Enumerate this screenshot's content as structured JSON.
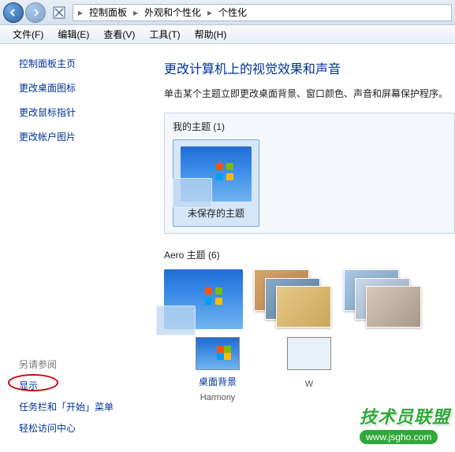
{
  "breadcrumb": {
    "items": [
      "控制面板",
      "外观和个性化",
      "个性化"
    ]
  },
  "menu": {
    "items": [
      "文件(F)",
      "编辑(E)",
      "查看(V)",
      "工具(T)",
      "帮助(H)"
    ]
  },
  "sidebar": {
    "title": "控制面板主页",
    "links": [
      "更改桌面图标",
      "更改鼠标指针",
      "更改帐户图片"
    ],
    "seeAlsoTitle": "另请参阅",
    "seeAlso": [
      "显示",
      "任务栏和「开始」菜单",
      "轻松访问中心"
    ]
  },
  "main": {
    "title": "更改计算机上的视觉效果和声音",
    "desc": "单击某个主题立即更改桌面背景、窗口颜色、声音和屏幕保护程序。",
    "myThemesTitle": "我的主题 (1)",
    "unsavedTheme": "未保存的主题",
    "aeroTitle": "Aero 主题 (6)"
  },
  "bottom": {
    "items": [
      {
        "label": "桌面背景",
        "sublabel": "Harmony"
      },
      {
        "label": "",
        "sublabel": "W"
      }
    ]
  },
  "watermark": {
    "text": "技术员联盟",
    "url": "www.jsgho.com"
  }
}
